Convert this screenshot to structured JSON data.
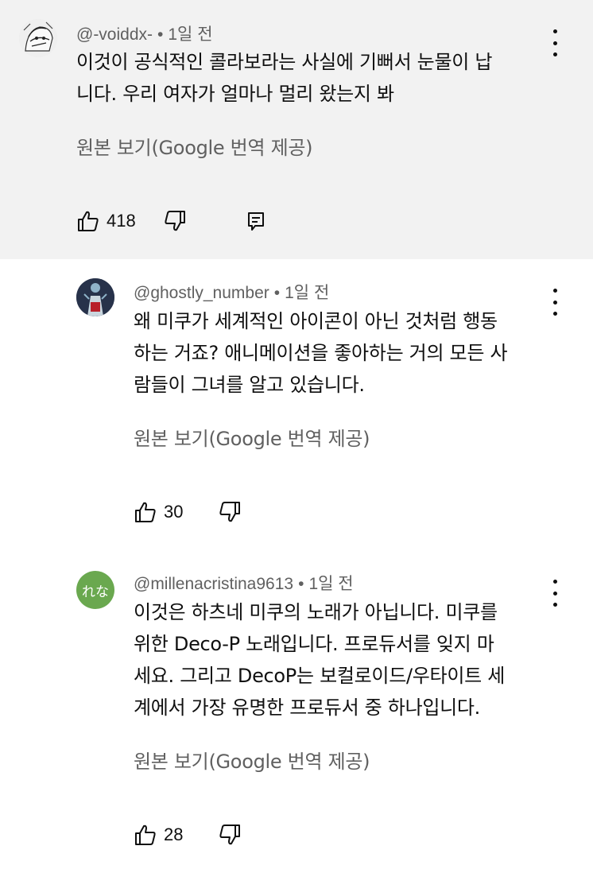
{
  "comments": [
    {
      "author": "@-voiddx-",
      "time": "1일 전",
      "lines": [
        "이것이 공식적인 콜라보라는 사실에 기뻐서 눈물이 납",
        "니다. 우리 여자가 얼마나 멀리 왔는지 봐"
      ],
      "translate": "원본 보기(Google 번역 제공)",
      "likes": "418"
    },
    {
      "author": "@ghostly_number",
      "time": "1일 전",
      "lines": [
        "왜 미쿠가 세계적인 아이콘이 아닌 것처럼 행동",
        "하는 거죠? 애니메이션을 좋아하는 거의 모든 사",
        "람들이 그녀를 알고 있습니다."
      ],
      "translate": "원본 보기(Google 번역 제공)",
      "likes": "30"
    },
    {
      "author": "@millenacristina9613",
      "avatar_text": "れな",
      "time": "1일 전",
      "lines": [
        "이것은 하츠네 미쿠의 노래가 아닙니다. 미쿠를",
        "위한 Deco-P 노래입니다. 프로듀서를 잊지 마",
        "세요. 그리고 DecoP는 보컬로이드/우타이트 세",
        "계에서 가장 유명한 프로듀서 중 하나입니다."
      ],
      "translate": "원본 보기(Google 번역 제공)",
      "likes": "28"
    }
  ],
  "colors": {
    "top_bg": "#f2f2f2",
    "meta": "#606060",
    "text": "#0f0f0f",
    "avatar3": "#6aa84f"
  },
  "icons": [
    "thumb-up-icon",
    "thumb-down-icon",
    "reply-icon",
    "more-vert-icon"
  ]
}
